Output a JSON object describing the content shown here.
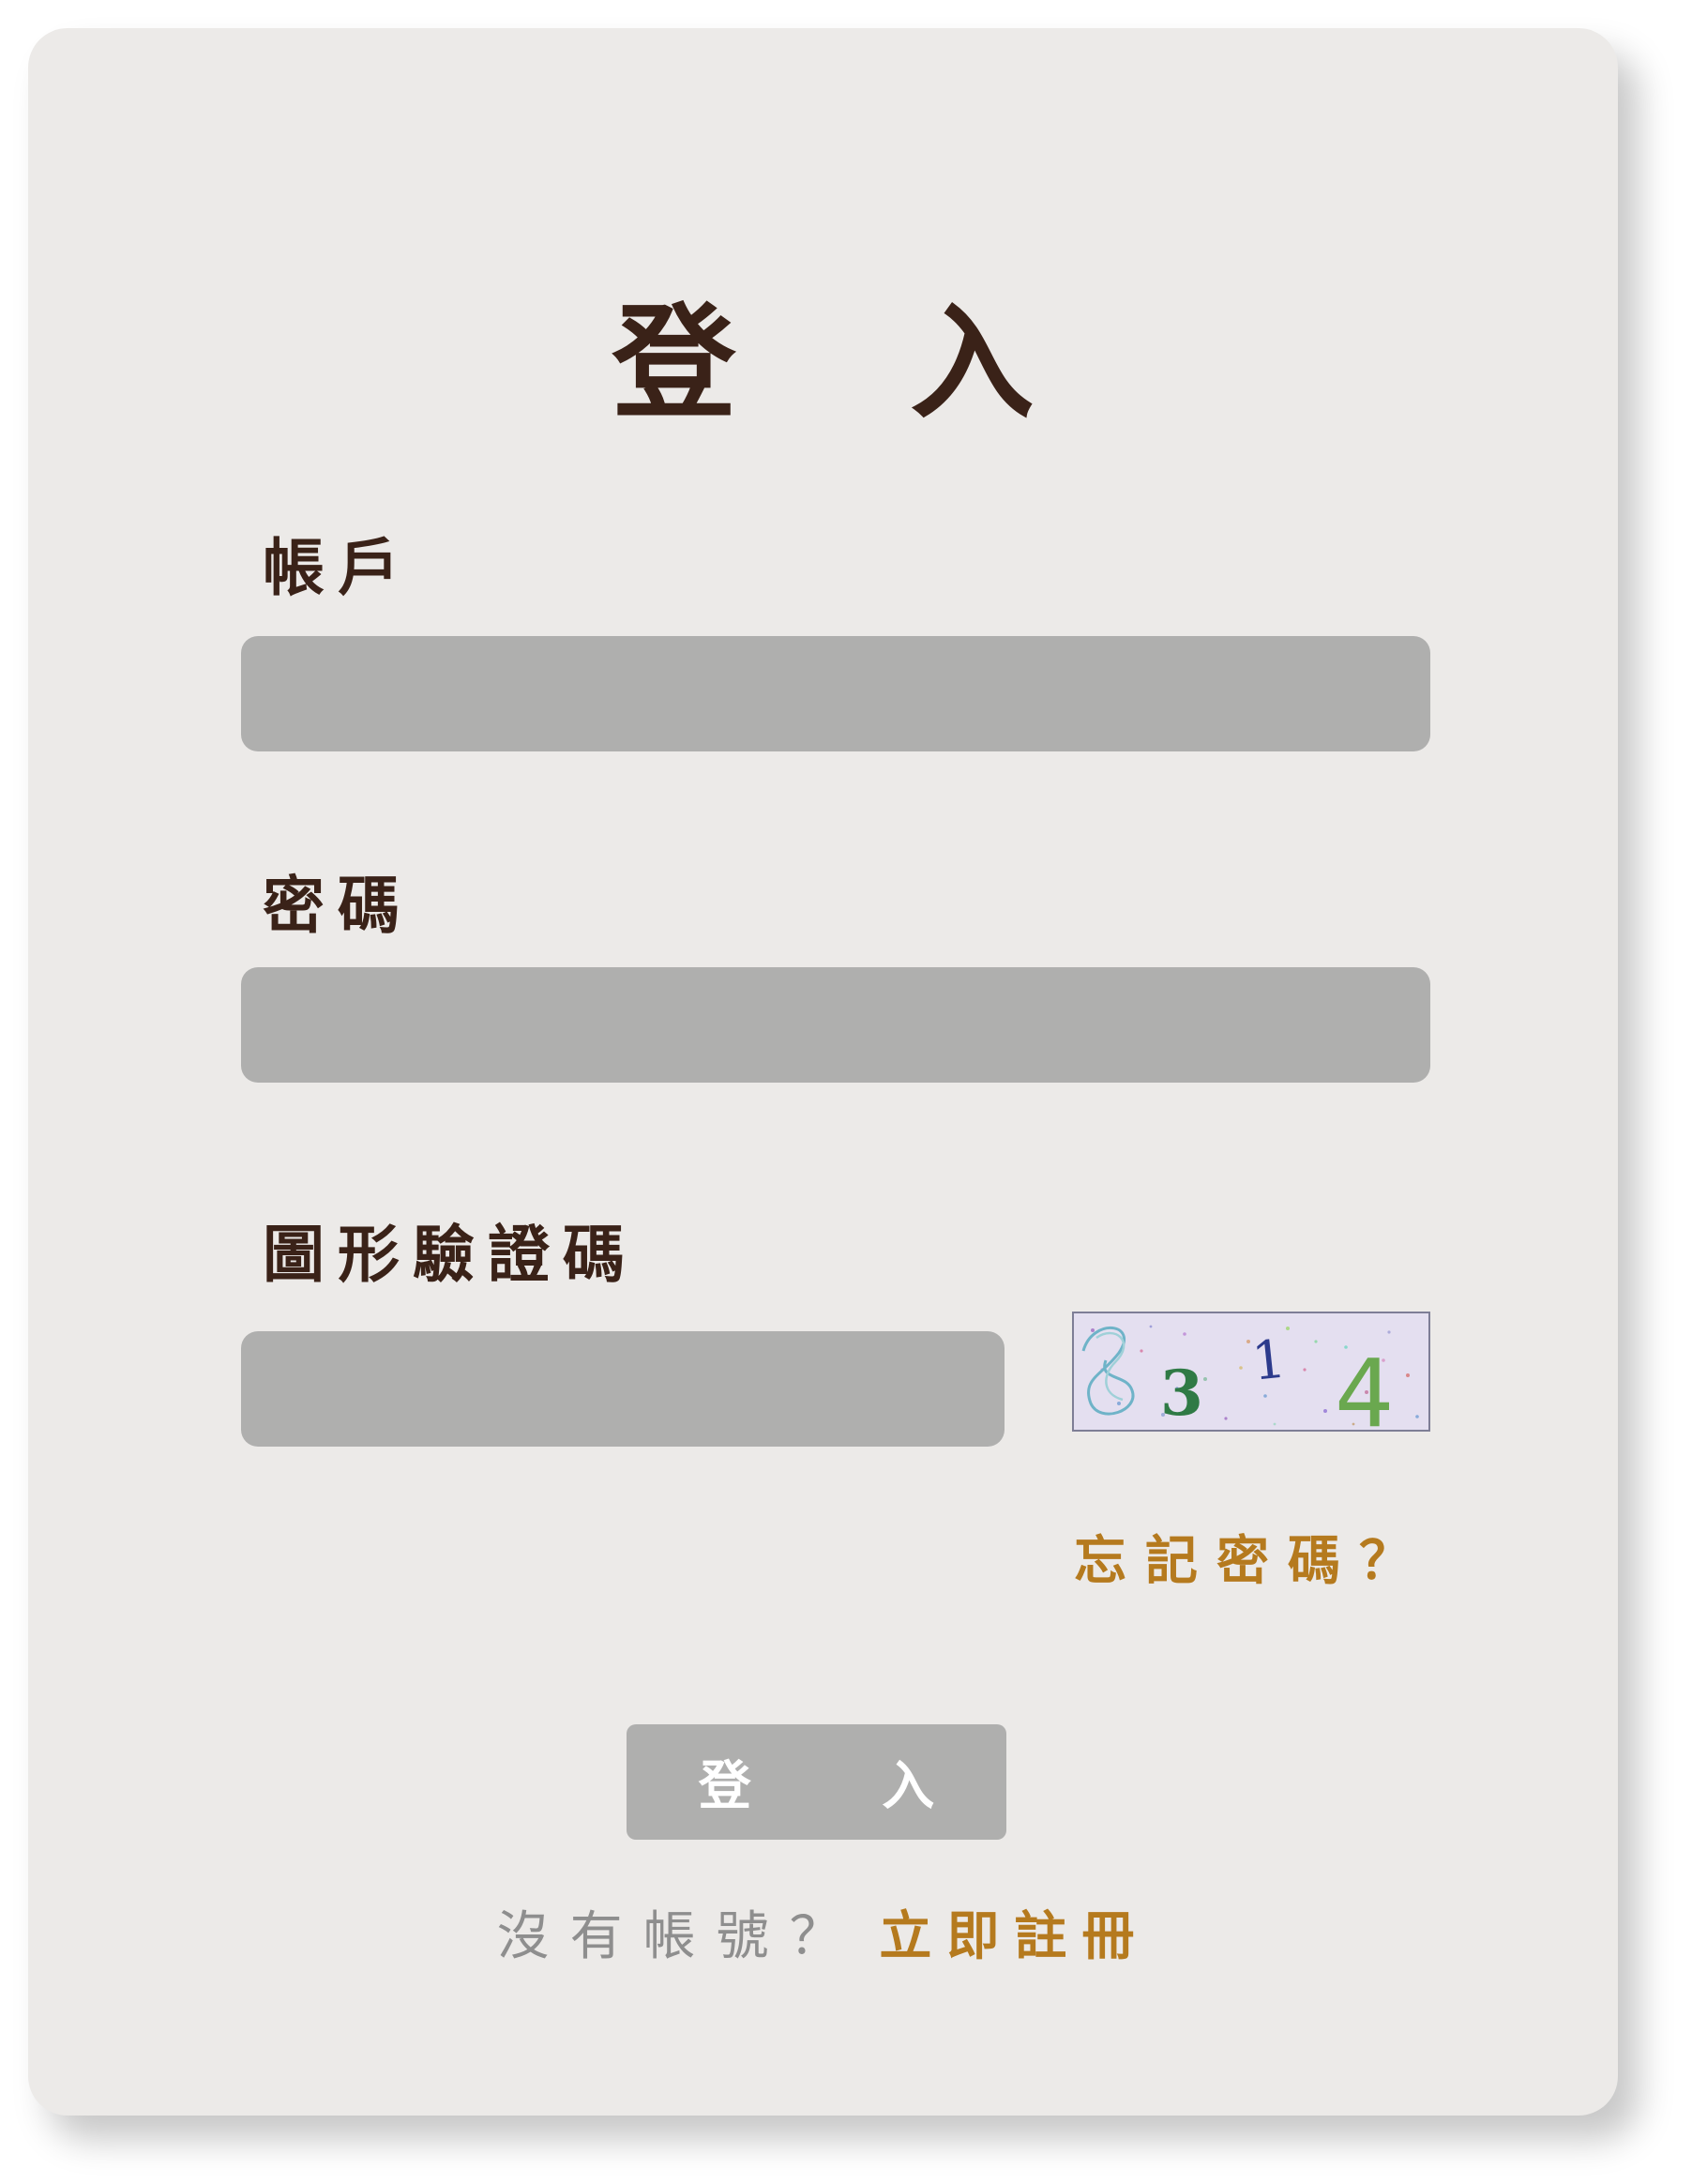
{
  "title": "登 入",
  "account": {
    "label": "帳戶",
    "value": "",
    "placeholder": ""
  },
  "password": {
    "label": "密碼",
    "value": "",
    "placeholder": ""
  },
  "captcha": {
    "label": "圖形驗證碼",
    "value": "",
    "placeholder": "",
    "digits": [
      "3",
      "1",
      "4"
    ]
  },
  "forgot_password": "忘記密碼？",
  "submit_label": "登 入",
  "signup": {
    "prompt": "沒有帳號？",
    "link": "立即註冊"
  },
  "colors": {
    "card_background": "#ECEAE8",
    "heading_text": "#3A2218",
    "input_background": "#AFAFAE",
    "link_accent": "#B57A1E",
    "muted_text": "#8E8E8E",
    "button_text": "#FFFFFF"
  },
  "icons": {
    "captcha": "captcha-image"
  }
}
